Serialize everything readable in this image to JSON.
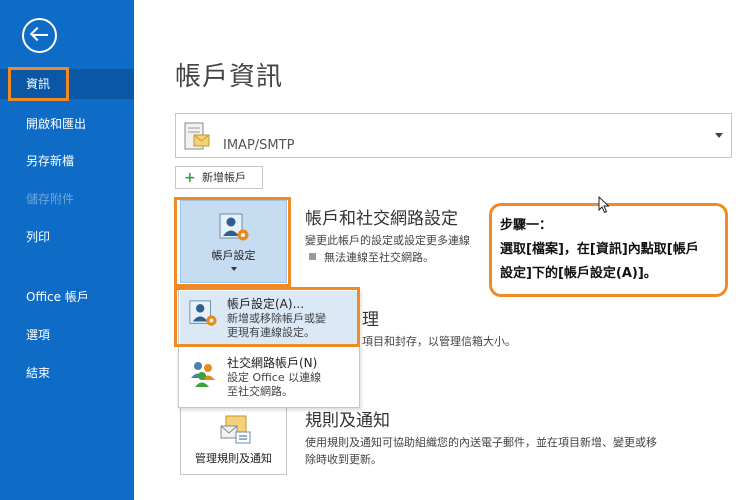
{
  "sidebar": {
    "items": [
      {
        "label": "資訊",
        "state": "active"
      },
      {
        "label": "開啟和匯出",
        "state": "normal"
      },
      {
        "label": "另存新檔",
        "state": "normal"
      },
      {
        "label": "儲存附件",
        "state": "disabled"
      },
      {
        "label": "列印",
        "state": "normal"
      },
      {
        "label": "Office 帳戶",
        "state": "normal"
      },
      {
        "label": "選項",
        "state": "normal"
      },
      {
        "label": "結束",
        "state": "normal"
      }
    ]
  },
  "main": {
    "title": "帳戶資訊",
    "account_selector": {
      "value": "IMAP/SMTP"
    },
    "add_account_label": "新增帳戶",
    "account_settings_tile": {
      "label": "帳戶設定"
    },
    "account_section": {
      "heading": "帳戶和社交網路設定",
      "desc": "變更此帳戶的設定或設定更多連線",
      "status": "無法連線至社交網路。"
    },
    "menu": {
      "items": [
        {
          "title": "帳戶設定(A)...",
          "desc": "新增或移除帳戶或變\n更現有連線設定。"
        },
        {
          "title": "社交網路帳戶(N)",
          "desc": "設定 Office 以連線\n至社交網路。"
        }
      ]
    },
    "cleanup_section": {
      "heading_partial": "理",
      "desc_partial": "項目和封存，以管理信箱大小。"
    },
    "rules_section": {
      "heading": "規則及通知",
      "desc_line1": "使用規則及通知可協助組織您的內送電子郵件，並在項目新增、變更或移",
      "desc_line2": "除時收到更新。",
      "tile_label": "管理規則及通知"
    }
  },
  "annotation": {
    "lines": [
      "步驟一：",
      "選取[檔案]，在[資訊]內點取[帳戶",
      "設定]下的[帳戶設定(A)]。"
    ]
  },
  "colors": {
    "sidebar": "#0f6cc6",
    "highlight_outline": "#f08a24",
    "tile_selected": "#c5dcf1"
  },
  "icons": [
    "back-arrow-icon",
    "mail-server-icon",
    "plus-icon",
    "person-gear-icon",
    "people-icon",
    "rules-envelope-icon",
    "chevron-down-icon",
    "cursor-icon"
  ]
}
